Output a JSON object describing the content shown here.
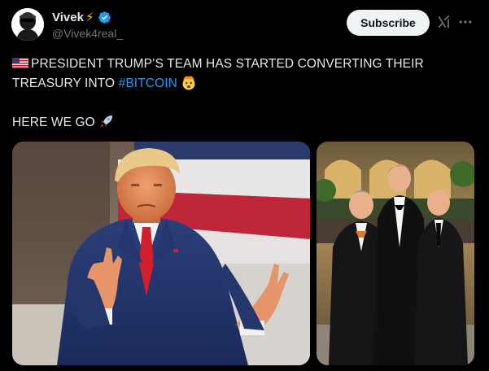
{
  "author": {
    "display_name": "Vivek",
    "handle": "@Vivek4real_"
  },
  "actions": {
    "subscribe_label": "Subscribe"
  },
  "tweet": {
    "line1": "PRESIDENT TRUMP’S TEAM HAS STARTED CONVERTING THEIR",
    "line2_prefix": "TREASURY INTO ",
    "hashtag": "#BITCOIN",
    "line3": "HERE WE GO"
  },
  "icons": {
    "verified": "verified-badge-icon",
    "grok": "grok-icon",
    "more": "more-options-icon",
    "flag": "us-flag-emoji",
    "mind_blown": "exploding-head-emoji",
    "rocket": "rocket-emoji"
  },
  "colors": {
    "background": "#000000",
    "text": "#e7e9ea",
    "secondary": "#71767b",
    "link": "#1d9bf0",
    "verified": "#1d9bf0",
    "subscribe_bg": "#eff3f4"
  }
}
